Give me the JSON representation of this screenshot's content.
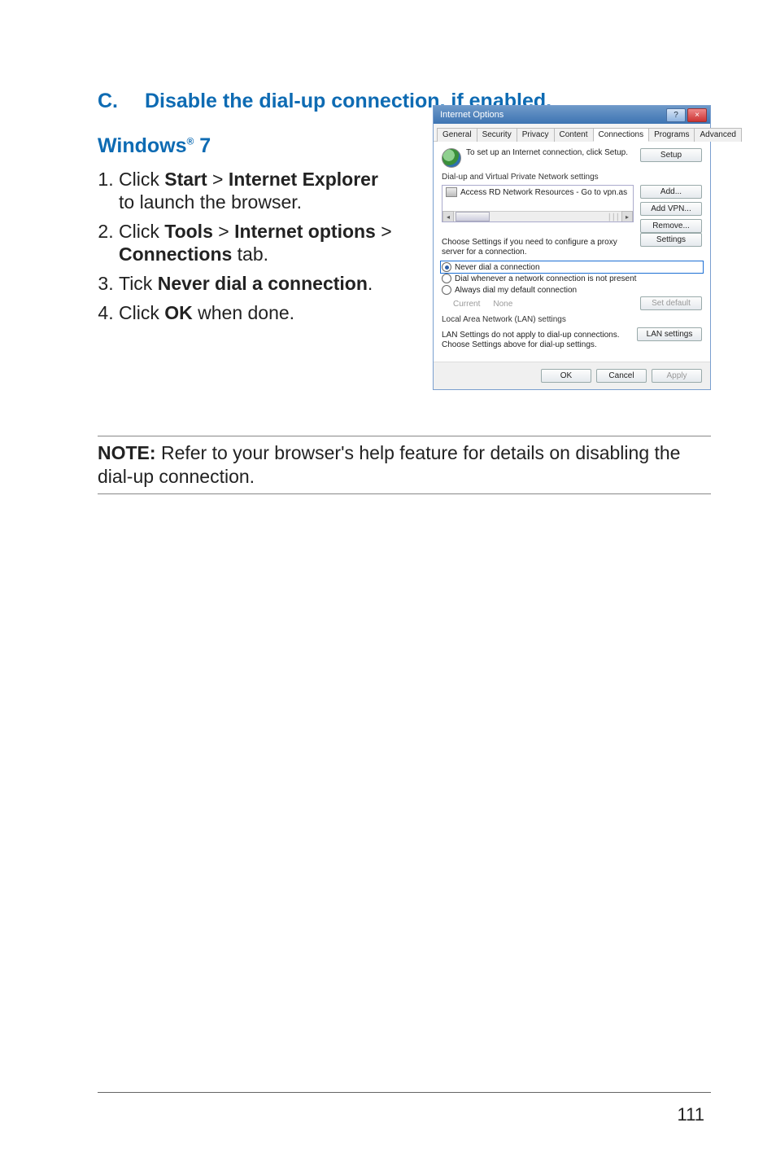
{
  "section": {
    "letter": "C.",
    "title": "Disable the dial-up connection, if enabled."
  },
  "subheading": {
    "prefix": "Windows",
    "reg": "®",
    "suffix": " 7"
  },
  "steps": {
    "s1a": "Click ",
    "s1b": "Start",
    "s1c": " > ",
    "s1d": "Internet Explorer",
    "s1e": "to launch the browser.",
    "s2a": "Click ",
    "s2b": "Tools",
    "s2c": " > ",
    "s2d": "Internet options",
    "s2e": " > ",
    "s2f": "Connections",
    "s2g": " tab.",
    "s3a": "Tick ",
    "s3b": "Never dial a connection",
    "s3c": ".",
    "s4a": "Click ",
    "s4b": "OK",
    "s4c": " when done."
  },
  "note": {
    "label": "NOTE:",
    "text": " Refer to your browser's help feature for details on disabling the dial-up connection."
  },
  "page_number": "111",
  "dialog": {
    "title": "Internet Options",
    "help_glyph": "?",
    "close_glyph": "×",
    "tabs": {
      "general": "General",
      "security": "Security",
      "privacy": "Privacy",
      "content": "Content",
      "connections": "Connections",
      "programs": "Programs",
      "advanced": "Advanced"
    },
    "setup_text": "To set up an Internet connection, click Setup.",
    "setup_btn": "Setup",
    "dialup_title": "Dial-up and Virtual Private Network settings",
    "list_item": "Access RD Network Resources - Go to vpn.as",
    "add_btn": "Add...",
    "addvpn_btn": "Add VPN...",
    "remove_btn": "Remove...",
    "proxy_text": "Choose Settings if you need to configure a proxy server for a connection.",
    "settings_btn": "Settings",
    "radio_never": "Never dial a connection",
    "radio_whenever": "Dial whenever a network connection is not present",
    "radio_always": "Always dial my default connection",
    "current_label": "Current",
    "current_value": "None",
    "setdefault_btn": "Set default",
    "lan_title": "Local Area Network (LAN) settings",
    "lan_text": "LAN Settings do not apply to dial-up connections. Choose Settings above for dial-up settings.",
    "lan_btn": "LAN settings",
    "ok_btn": "OK",
    "cancel_btn": "Cancel",
    "apply_btn": "Apply",
    "scroll_left": "◂",
    "scroll_right": "▸",
    "scroll_mid": "│││"
  }
}
